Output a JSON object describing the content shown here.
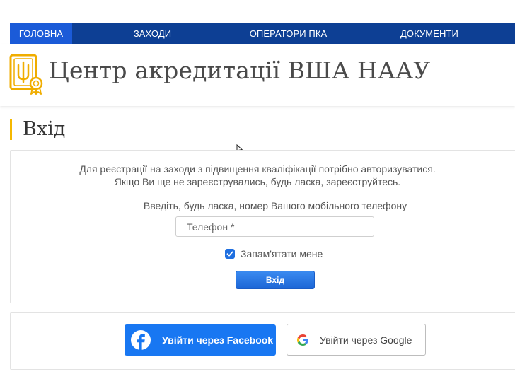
{
  "nav": {
    "items": [
      {
        "label": "ГОЛОВНА",
        "active": true
      },
      {
        "label": "ЗАХОДИ",
        "active": false
      },
      {
        "label": "ОПЕРАТОРИ ПКА",
        "active": false
      },
      {
        "label": "ДОКУМЕНТИ",
        "active": false
      }
    ]
  },
  "header": {
    "title": "Центр акредитації ВША НААУ",
    "logo_icon": "trident-certificate-icon"
  },
  "page": {
    "heading": "Вхід"
  },
  "login": {
    "intro_line1": "Для реєстрації на заходи з підвищення кваліфікації потрібно авторизуватися.",
    "intro_line2": "Якщо Ви ще не зареєструвались, будь ласка, зареєструйтесь.",
    "phone_label": "Введіть, будь ласка, номер Вашого мобільного телефону",
    "phone_placeholder": "Телефон *",
    "phone_value": "",
    "remember_label": "Запам'ятати мене",
    "remember_checked": true,
    "submit_label": "Вхід"
  },
  "social": {
    "facebook_label": "Увійти через Facebook",
    "google_label": "Увійти через Google"
  },
  "colors": {
    "nav_bg": "#0d3f94",
    "nav_active": "#1b5bd8",
    "accent_gold": "#f5b800",
    "primary_button": "#1f6fe0",
    "facebook": "#1877f2"
  }
}
